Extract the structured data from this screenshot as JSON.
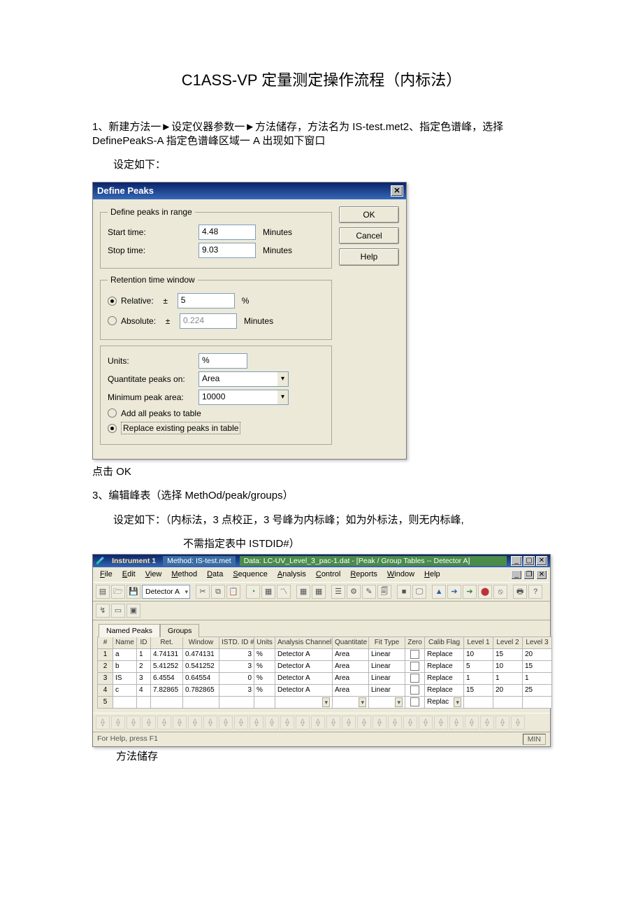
{
  "doc": {
    "title": "C1ASS-VP 定量测定操作流程（内标法）",
    "para1a": "1、新建方法一►设定仪器参数一►方法储存，方法名为 IS-test.met2、指定色谱峰，选择 DefinePeakS-A 指定色谱峰区域一 A 出现如下窗口",
    "para2": "设定如下：",
    "after_dialog": "点击 OK",
    "para3": "3、编辑峰表（选择 MethOd/peak/groups）",
    "para4": "设定如下：（内标法，3 点校正，3 号峰为内标峰；如为外标法，则无内标峰,",
    "para5": "不需指定表中 ISTDID#）",
    "after_app": "方法储存"
  },
  "dlg": {
    "title": "Define Peaks",
    "close_glyph": "✕",
    "buttons": {
      "ok": "OK",
      "cancel": "Cancel",
      "help": "Help"
    },
    "range": {
      "legend": "Define peaks in range",
      "start_label": "Start time:",
      "start_value": "4.48",
      "start_unit": "Minutes",
      "stop_label": "Stop time:",
      "stop_value": "9.03",
      "stop_unit": "Minutes"
    },
    "rtwin": {
      "legend": "Retention time window",
      "relative_label": "Relative:",
      "relative_value": "5",
      "relative_unit": "%",
      "absolute_label": "Absolute:",
      "absolute_value": "0.224",
      "absolute_unit": "Minutes"
    },
    "lower": {
      "units_label": "Units:",
      "units_value": "%",
      "quant_label": "Quantitate peaks on:",
      "quant_value": "Area",
      "min_label": "Minimum peak area:",
      "min_value": "10000",
      "opt_add": "Add all peaks to table",
      "opt_replace": "Replace existing peaks in table"
    }
  },
  "app": {
    "title_name": "Instrument 1",
    "title_method": "Method: IS-test.met",
    "title_data": "Data: LC-UV_Level_3_pac-1.dat - [Peak / Group Tables -- Detector A]",
    "detector": "Detector A",
    "menu": [
      "File",
      "Edit",
      "View",
      "Method",
      "Data",
      "Sequence",
      "Analysis",
      "Control",
      "Reports",
      "Window",
      "Help"
    ],
    "tabs": {
      "named": "Named Peaks",
      "groups": "Groups"
    },
    "columns": [
      "#",
      "Name",
      "ID",
      "Ret.",
      "Window",
      "ISTD. ID #",
      "Units",
      "Analysis Channel",
      "Quantitate",
      "Fit Type",
      "Zero",
      "Calib Flag",
      "Level 1",
      "Level 2",
      "Level 3"
    ],
    "rows": [
      {
        "num": "1",
        "name": "a",
        "id": "1",
        "ret": "4.74131",
        "window": "0.474131",
        "istd": "3",
        "units": "%",
        "chan": "Detector A",
        "quant": "Area",
        "fit": "Linear",
        "zero": false,
        "calib": "Replace",
        "l1": "10",
        "l2": "15",
        "l3": "20"
      },
      {
        "num": "2",
        "name": "b",
        "id": "2",
        "ret": "5.41252",
        "window": "0.541252",
        "istd": "3",
        "units": "%",
        "chan": "Detector A",
        "quant": "Area",
        "fit": "Linear",
        "zero": false,
        "calib": "Replace",
        "l1": "5",
        "l2": "10",
        "l3": "15"
      },
      {
        "num": "3",
        "name": "IS",
        "id": "3",
        "ret": "6.4554",
        "window": "0.64554",
        "istd": "0",
        "units": "%",
        "chan": "Detector A",
        "quant": "Area",
        "fit": "Linear",
        "zero": false,
        "calib": "Replace",
        "l1": "1",
        "l2": "1",
        "l3": "1"
      },
      {
        "num": "4",
        "name": "c",
        "id": "4",
        "ret": "7.82865",
        "window": "0.782865",
        "istd": "3",
        "units": "%",
        "chan": "Detector A",
        "quant": "Area",
        "fit": "Linear",
        "zero": false,
        "calib": "Replace",
        "l1": "15",
        "l2": "20",
        "l3": "25"
      }
    ],
    "edit_row_calib": "Replac",
    "status_left": "For Help, press F1",
    "status_right": "MIN"
  }
}
